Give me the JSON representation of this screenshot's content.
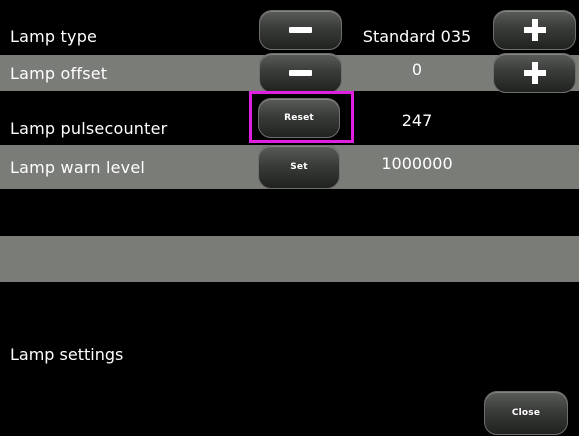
{
  "rows": [
    {
      "label": "Lamp type",
      "value": "Standard 035"
    },
    {
      "label": "Lamp offset",
      "value": "0"
    },
    {
      "label": "Lamp pulsecounter",
      "value": "247",
      "button": "Reset"
    },
    {
      "label": "Lamp warn level",
      "value": "1000000",
      "button": "Set"
    }
  ],
  "footer": {
    "label": "Lamp settings",
    "close": "Close"
  },
  "colors": {
    "grey_band": "#7a7c78",
    "highlight": "#e020e0",
    "background": "#000000"
  },
  "icons": {
    "decrement": "minus-icon",
    "increment": "plus-icon"
  }
}
